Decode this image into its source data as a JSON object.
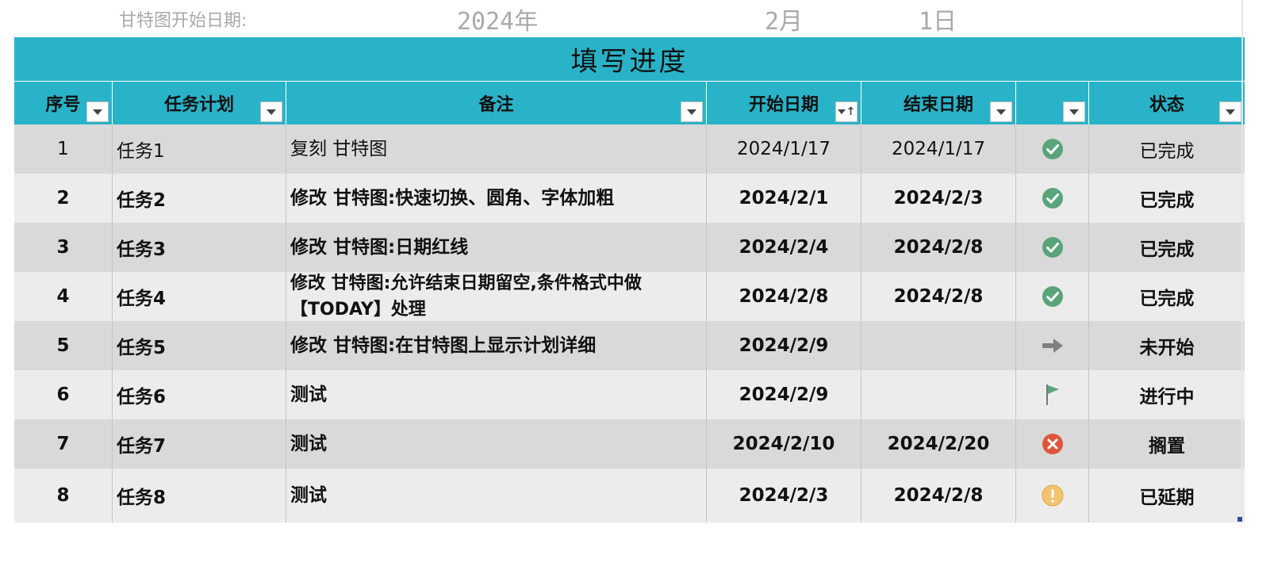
{
  "header": {
    "label": "甘特图开始日期:",
    "year": "2024年",
    "month": "2月",
    "day": "1日"
  },
  "title": "填写进度",
  "columns": {
    "no": "序号",
    "task": "任务计划",
    "remark": "备注",
    "start": "开始日期",
    "end": "结束日期",
    "icon": "",
    "status": "状态"
  },
  "rows": [
    {
      "no": "1",
      "task": "任务1",
      "remark": "复刻 甘特图",
      "start": "2024/1/17",
      "end": "2024/1/17",
      "icon": "check-circle-icon",
      "status": "已完成"
    },
    {
      "no": "2",
      "task": "任务2",
      "remark": "修改 甘特图:快速切换、圆角、字体加粗",
      "start": "2024/2/1",
      "end": "2024/2/3",
      "icon": "check-circle-icon",
      "status": "已完成"
    },
    {
      "no": "3",
      "task": "任务3",
      "remark": "修改 甘特图:日期红线",
      "start": "2024/2/4",
      "end": "2024/2/8",
      "icon": "check-circle-icon",
      "status": "已完成"
    },
    {
      "no": "4",
      "task": "任务4",
      "remark": "修改 甘特图:允许结束日期留空,条件格式中做【TODAY】处理",
      "start": "2024/2/8",
      "end": "2024/2/8",
      "icon": "check-circle-icon",
      "status": "已完成"
    },
    {
      "no": "5",
      "task": "任务5",
      "remark": "修改 甘特图:在甘特图上显示计划详细",
      "start": "2024/2/9",
      "end": "",
      "icon": "arrow-right-icon",
      "status": "未开始"
    },
    {
      "no": "6",
      "task": "任务6",
      "remark": "测试",
      "start": "2024/2/9",
      "end": "",
      "icon": "flag-icon",
      "status": "进行中"
    },
    {
      "no": "7",
      "task": "任务7",
      "remark": "测试",
      "start": "2024/2/10",
      "end": "2024/2/20",
      "icon": "x-circle-icon",
      "status": "搁置"
    },
    {
      "no": "8",
      "task": "任务8",
      "remark": "测试",
      "start": "2024/2/3",
      "end": "2024/2/8",
      "icon": "exclamation-circle-icon",
      "status": "已延期"
    }
  ],
  "colors": {
    "header_bg": "#29b3c8",
    "row_odd": "#d9d9d9",
    "row_even": "#ececec",
    "check": "#5aa47a",
    "error": "#e0553a",
    "warning": "#f2c46d",
    "arrow": "#808080",
    "flag": "#5aa47a"
  }
}
